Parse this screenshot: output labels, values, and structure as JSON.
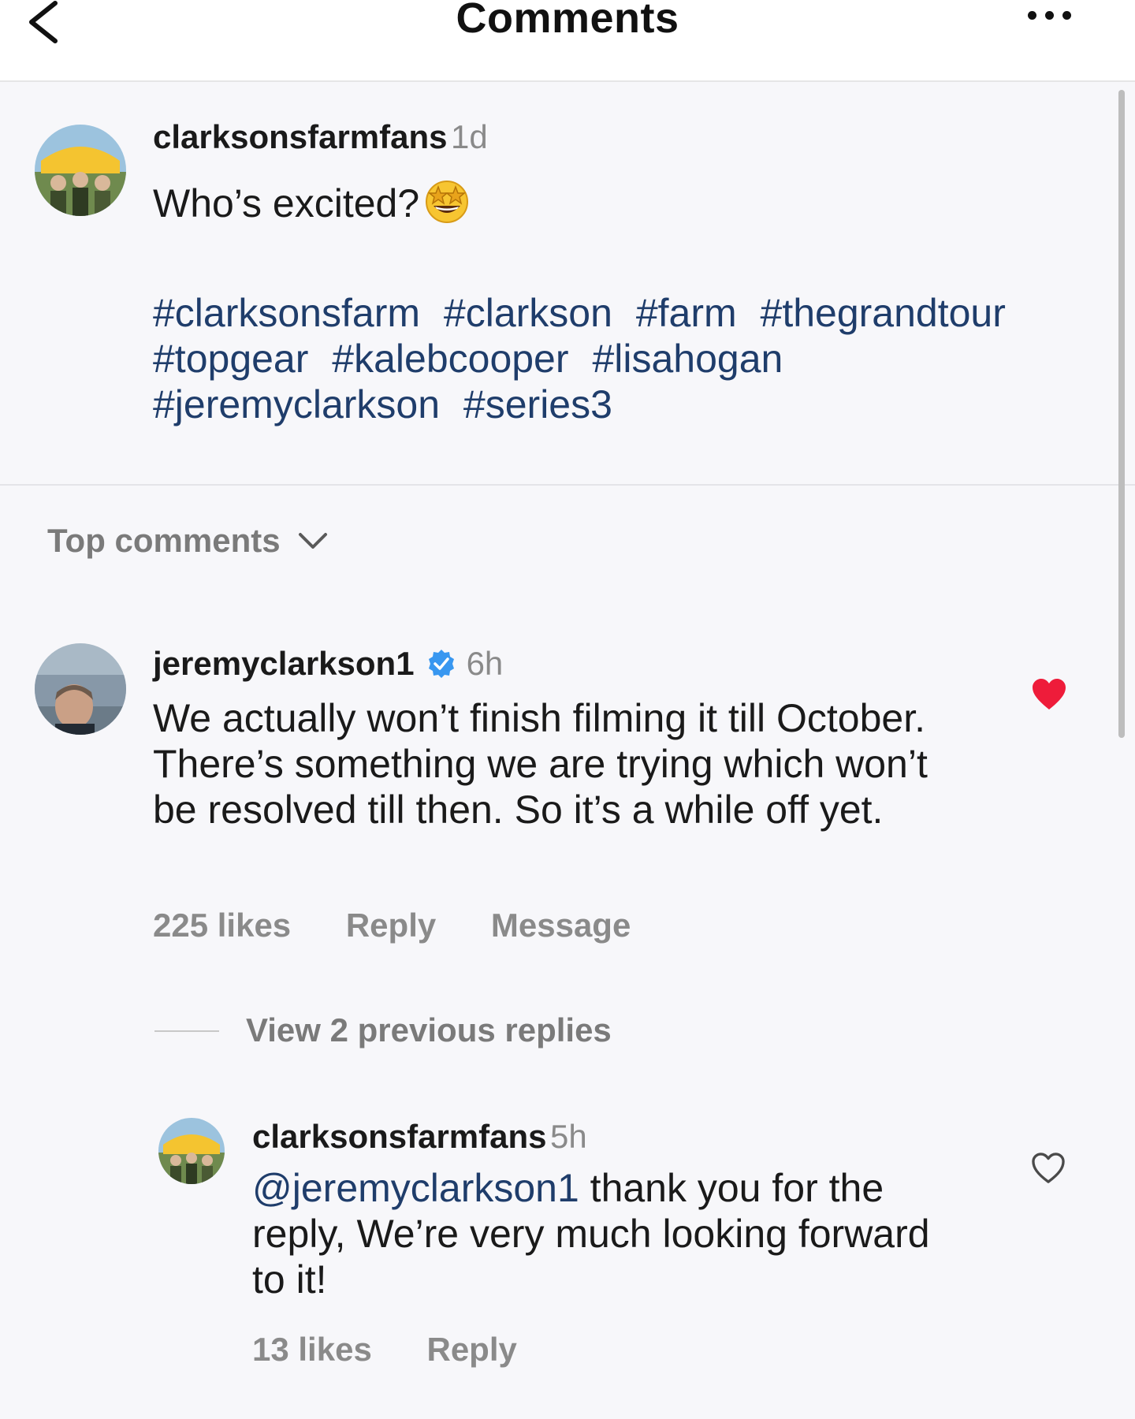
{
  "header": {
    "title": "Comments",
    "back_icon": "chevron-left-icon",
    "more_icon": "more-horizontal-icon"
  },
  "post": {
    "username": "clarksonsfarmfans",
    "time": "1d",
    "text": "Who’s excited?",
    "emoji": "star-struck-emoji",
    "hashtags": [
      "#clarksonsfarm",
      "#clarkson",
      "#farm",
      "#thegrandtour",
      "#topgear",
      "#kalebcooper",
      "#lisahogan",
      "#jeremyclarkson",
      "#series3"
    ]
  },
  "sort": {
    "label": "Top comments",
    "icon": "chevron-down-icon"
  },
  "comments": [
    {
      "username": "jeremyclarkson1",
      "verified": true,
      "time": "6h",
      "text": "We actually won’t finish filming it till October. There’s something we are trying which won’t be resolved till then. So it’s a while off yet.",
      "likes": "225 likes",
      "reply_label": "Reply",
      "message_label": "Message",
      "liked": true,
      "heart_color": "#ee1c3a"
    }
  ],
  "view_replies": "View 2 previous replies",
  "reply": {
    "username": "clarksonsfarmfans",
    "time": "5h",
    "mention": "@jeremyclarkson1",
    "text": " thank you for the reply, We’re very much looking forward to it!",
    "likes": "13 likes",
    "reply_label": "Reply",
    "liked": false
  },
  "colors": {
    "hashtag": "#1f3d6b",
    "verified": "#3897f0",
    "muted": "#8a8a8a",
    "background": "#f7f7fa"
  }
}
